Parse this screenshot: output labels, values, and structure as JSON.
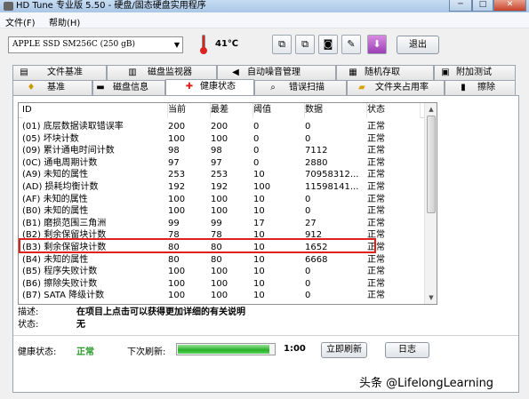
{
  "window": {
    "title": "HD Tune 专业版 5.50 - 硬盘/固态硬盘实用程序",
    "minimize": "─",
    "maximize": "□",
    "close": "✕"
  },
  "menu": {
    "items": [
      {
        "label": "文件(F)"
      },
      {
        "label": "帮助(H)"
      }
    ]
  },
  "toolbar": {
    "drive": "APPLE SSD SM256C (250 gB)",
    "temperature": "41℃",
    "exit_label": "退出"
  },
  "tabs": {
    "row1": [
      {
        "label": "文件基准",
        "icon": "file-benchmark-icon"
      },
      {
        "label": "磁盘监视器",
        "icon": "disk-monitor-icon"
      },
      {
        "label": "自动噪音管理",
        "icon": "speaker-icon"
      },
      {
        "label": "随机存取",
        "icon": "random-access-icon"
      },
      {
        "label": "附加测试",
        "icon": "extra-tests-icon"
      }
    ],
    "row2": [
      {
        "label": "基准",
        "icon": "benchmark-icon"
      },
      {
        "label": "磁盘信息",
        "icon": "disk-info-icon"
      },
      {
        "label": "健康状态",
        "icon": "health-cross-icon",
        "active": true
      },
      {
        "label": "错误扫描",
        "icon": "error-scan-icon"
      },
      {
        "label": "文件夹占用率",
        "icon": "folder-icon"
      },
      {
        "label": "擦除",
        "icon": "erase-icon"
      }
    ]
  },
  "smart": {
    "columns": [
      "ID",
      "当前",
      "最差",
      "阈值",
      "数据",
      "状态"
    ],
    "rows": [
      {
        "id": "(01) 底层数据读取错误率",
        "cur": "200",
        "worst": "200",
        "thr": "0",
        "data": "0",
        "status": "正常"
      },
      {
        "id": "(05) 坏块计数",
        "cur": "100",
        "worst": "100",
        "thr": "0",
        "data": "0",
        "status": "正常"
      },
      {
        "id": "(09) 累计通电时间计数",
        "cur": "98",
        "worst": "98",
        "thr": "0",
        "data": "7112",
        "status": "正常"
      },
      {
        "id": "(0C) 通电周期计数",
        "cur": "97",
        "worst": "97",
        "thr": "0",
        "data": "2880",
        "status": "正常"
      },
      {
        "id": "(A9) 未知的属性",
        "cur": "253",
        "worst": "253",
        "thr": "10",
        "data": "70958312...",
        "status": "正常"
      },
      {
        "id": "(AD) 损耗均衡计数",
        "cur": "192",
        "worst": "192",
        "thr": "100",
        "data": "11598141...",
        "status": "正常"
      },
      {
        "id": "(AF) 未知的属性",
        "cur": "100",
        "worst": "100",
        "thr": "10",
        "data": "0",
        "status": "正常"
      },
      {
        "id": "(B0) 未知的属性",
        "cur": "100",
        "worst": "100",
        "thr": "10",
        "data": "0",
        "status": "正常"
      },
      {
        "id": "(B1) 磨损范围三角洲",
        "cur": "99",
        "worst": "99",
        "thr": "17",
        "data": "27",
        "status": "正常"
      },
      {
        "id": "(B2) 剩余保留块计数",
        "cur": "78",
        "worst": "78",
        "thr": "10",
        "data": "912",
        "status": "正常"
      },
      {
        "id": "(B3) 剩余保留块计数",
        "cur": "80",
        "worst": "80",
        "thr": "10",
        "data": "1652",
        "status": "正常"
      },
      {
        "id": "(B4) 未知的属性",
        "cur": "80",
        "worst": "80",
        "thr": "10",
        "data": "6668",
        "status": "正常"
      },
      {
        "id": "(B5) 程序失败计数",
        "cur": "100",
        "worst": "100",
        "thr": "10",
        "data": "0",
        "status": "正常"
      },
      {
        "id": "(B6) 擦除失败计数",
        "cur": "100",
        "worst": "100",
        "thr": "10",
        "data": "0",
        "status": "正常"
      },
      {
        "id": "(B7) SATA 降级计数",
        "cur": "100",
        "worst": "100",
        "thr": "10",
        "data": "0",
        "status": "正常"
      }
    ]
  },
  "details": {
    "desc_label": "描述:",
    "desc_text": "在项目上点击可以获得更加详细的有关说明",
    "state_label": "状态:",
    "state_text": "无"
  },
  "status_bar": {
    "health_label": "健康状态:",
    "health_value": "正常",
    "next_refresh_label": "下次刷新:",
    "refresh_progress": 0.95,
    "time": "1:00",
    "refresh_now_label": "立即刷新",
    "log_label": "日志"
  },
  "watermark": "头条 @LifelongLearning",
  "colors": {
    "highlight": "#e0201a",
    "health_ok": "#2c9a2c",
    "progress": "#25b025"
  }
}
